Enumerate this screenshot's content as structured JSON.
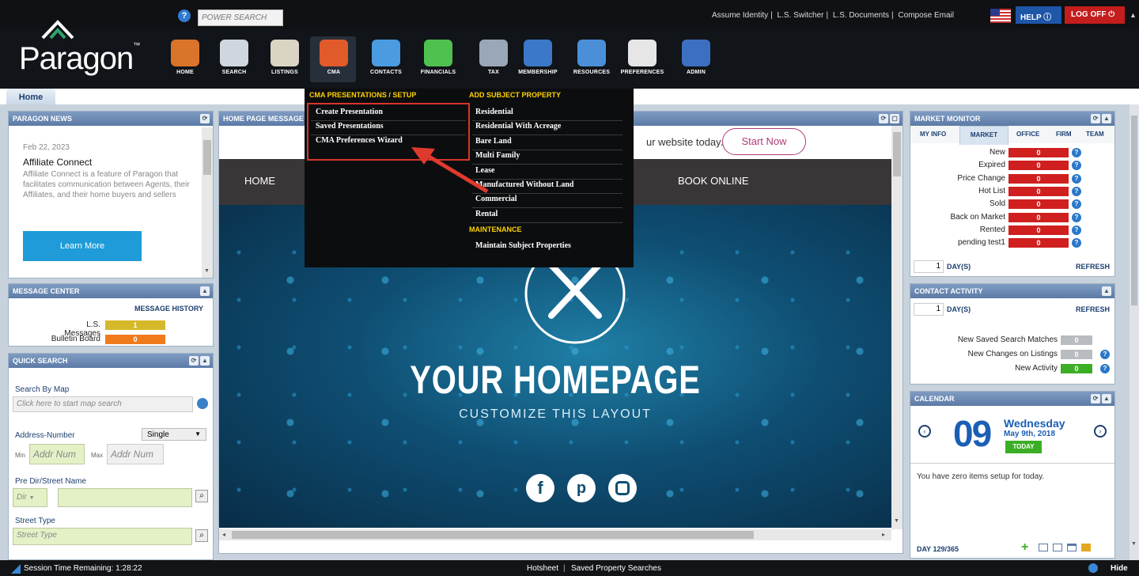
{
  "top": {
    "power_search_placeholder": "POWER SEARCH",
    "links": [
      "Assume Identity",
      "L.S. Switcher",
      "L.S. Documents",
      "Compose Email"
    ],
    "help_label": "HELP",
    "logoff_label": "LOG OFF"
  },
  "logo": {
    "text": "Paragon",
    "tm": "™"
  },
  "nav": [
    {
      "label": "HOME",
      "icon": "home-icon",
      "color": "#d9742a"
    },
    {
      "label": "SEARCH",
      "icon": "search-doc-icon",
      "color": "#cfd6de"
    },
    {
      "label": "LISTINGS",
      "icon": "listings-icon",
      "color": "#d9d4c4"
    },
    {
      "label": "CMA",
      "icon": "cma-icon",
      "color": "#e05a2a"
    },
    {
      "label": "CONTACTS",
      "icon": "contacts-icon",
      "color": "#4a9be0"
    },
    {
      "label": "FINANCIALS",
      "icon": "financials-icon",
      "color": "#4fc14f"
    },
    {
      "label": "TAX",
      "icon": "tax-icon",
      "color": "#9aa7b8"
    },
    {
      "label": "MEMBERSHIP",
      "icon": "membership-icon",
      "color": "#3b78c9"
    },
    {
      "label": "RESOURCES",
      "icon": "resources-icon",
      "color": "#4b8fd8"
    },
    {
      "label": "PREFERENCES",
      "icon": "preferences-icon",
      "color": "#e6e6e6"
    },
    {
      "label": "ADMIN",
      "icon": "admin-icon",
      "color": "#3d6fc0"
    }
  ],
  "home_tab": "Home",
  "news": {
    "title": "PARAGON NEWS",
    "date": "Feb 22, 2023",
    "headline": "Affiliate Connect",
    "body": "Affiliate Connect is a feature of Paragon that facilitates communication between Agents, their Affiliates, and their home buyers and sellers",
    "button": "Learn More"
  },
  "messages": {
    "title": "MESSAGE CENTER",
    "history": "MESSAGE HISTORY",
    "ls_label": "L.S. Messages",
    "ls_value": "1",
    "bulletin_label": "Bulletin Board",
    "bulletin_value": "0"
  },
  "quick": {
    "title": "QUICK SEARCH",
    "map_label": "Search By Map",
    "map_placeholder": "Click here to start map search",
    "addr_label": "Address-Number",
    "single": "Single",
    "min": "Min",
    "max": "Max",
    "addr_placeholder": "Addr Num",
    "street_label": "Pre Dir/Street Name",
    "dir": "Dir",
    "type_label": "Street Type",
    "type_placeholder": "Street Type"
  },
  "center": {
    "title": "HOME PAGE MESSAGE",
    "promo_text": "ur website today.",
    "start_now": "Start Now",
    "menu_home": "HOME",
    "menu_book": "BOOK ONLINE",
    "hero_title": "YOUR HOMEPAGE",
    "hero_sub": "CUSTOMIZE THIS LAYOUT"
  },
  "dropdown": {
    "col1_header": "CMA PRESENTATIONS / SETUP",
    "col1_items": [
      "Create Presentation",
      "Saved Presentations",
      "CMA Preferences Wizard"
    ],
    "col2_header": "ADD SUBJECT PROPERTY",
    "col2_items": [
      "Residential",
      "Residential With Acreage",
      "Bare Land",
      "Multi Family",
      "Lease",
      "Manufactured Without Land",
      "Commercial",
      "Rental"
    ],
    "maint_header": "MAINTENANCE",
    "maint_items": [
      "Maintain Subject Properties"
    ]
  },
  "market": {
    "title": "MARKET MONITOR",
    "tabs": [
      "MY INFO",
      "MARKET",
      "OFFICE",
      "FIRM",
      "TEAM"
    ],
    "rows": [
      {
        "label": "New",
        "value": "0"
      },
      {
        "label": "Expired",
        "value": "0"
      },
      {
        "label": "Price Change",
        "value": "0"
      },
      {
        "label": "Hot List",
        "value": "0"
      },
      {
        "label": "Sold",
        "value": "0"
      },
      {
        "label": "Back on Market",
        "value": "0"
      },
      {
        "label": "Rented",
        "value": "0"
      },
      {
        "label": "pending test1",
        "value": "0"
      }
    ],
    "days": "1",
    "days_label": "DAY(S)",
    "refresh": "REFRESH"
  },
  "contact": {
    "title": "CONTACT ACTIVITY",
    "days": "1",
    "days_label": "DAY(S)",
    "refresh": "REFRESH",
    "rows": [
      {
        "label": "New Saved Search Matches",
        "value": "0"
      },
      {
        "label": "New Changes on Listings",
        "value": "0"
      },
      {
        "label": "New Activity",
        "value": "0"
      }
    ]
  },
  "calendar": {
    "title": "CALENDAR",
    "day_num": "09",
    "weekday": "Wednesday",
    "date": "May 9th, 2018",
    "today": "TODAY",
    "empty_msg": "You have zero items setup for today.",
    "day_count": "DAY 129/365"
  },
  "status": {
    "session": "Session Time Remaining: 1:28:22",
    "hotsheet": "Hotsheet",
    "saved": "Saved Property Searches",
    "hide": "Hide"
  },
  "colors": {
    "accent_yellow": "#ffd200",
    "bar_red": "#d01f1f",
    "bar_yellow": "#d6b92a",
    "bar_orange": "#f07b1d",
    "bar_green": "#3cae25",
    "panel_head": "#5b7aa6",
    "highlight": "#d9342b"
  }
}
